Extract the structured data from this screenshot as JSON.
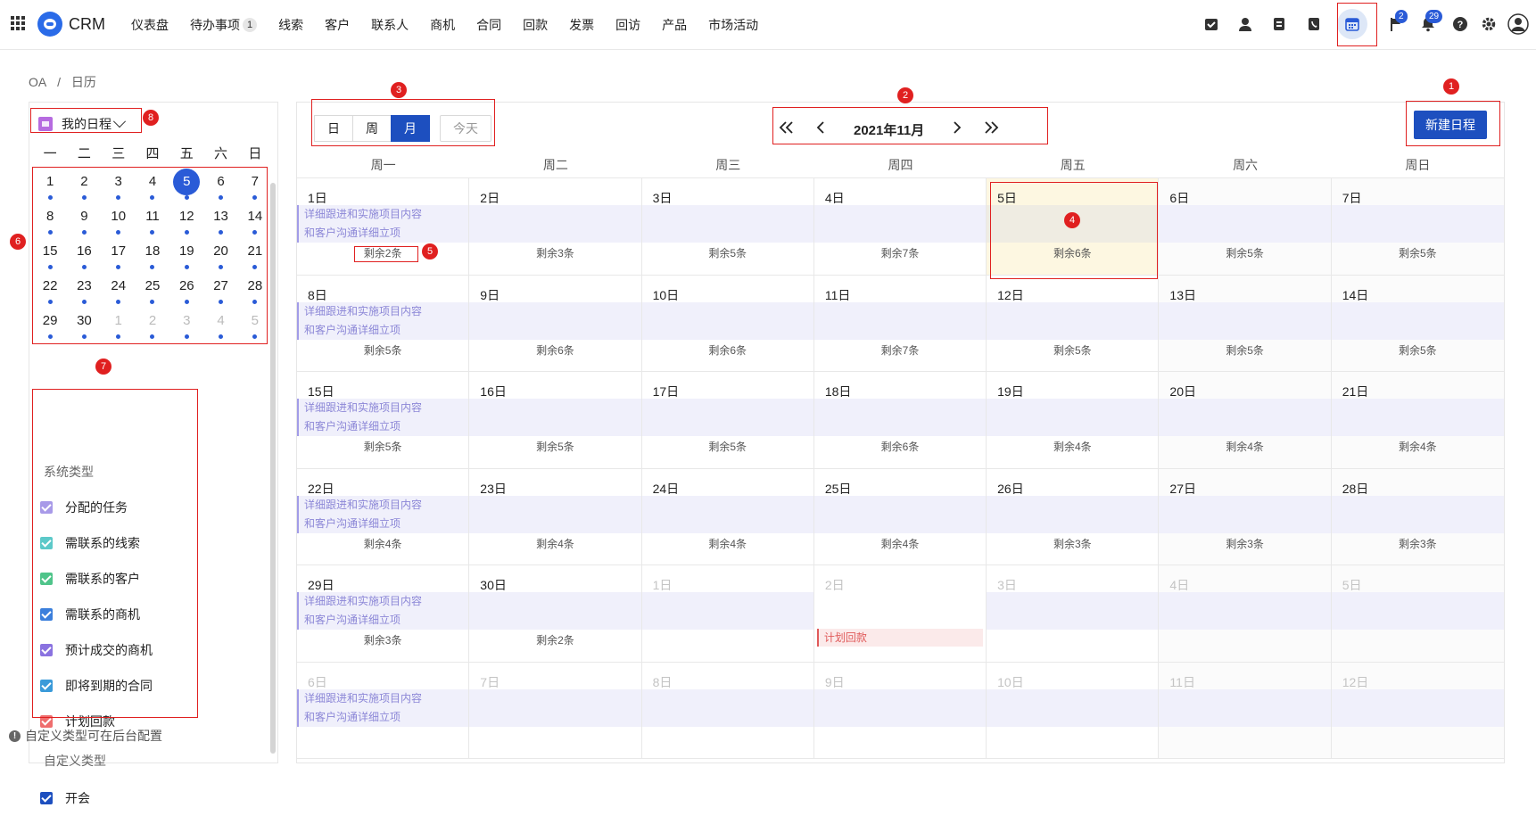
{
  "app": {
    "title": "CRM"
  },
  "nav": [
    {
      "label": "仪表盘"
    },
    {
      "label": "待办事项",
      "badge": "1"
    },
    {
      "label": "线索"
    },
    {
      "label": "客户"
    },
    {
      "label": "联系人"
    },
    {
      "label": "商机"
    },
    {
      "label": "合同"
    },
    {
      "label": "回款"
    },
    {
      "label": "发票"
    },
    {
      "label": "回访"
    },
    {
      "label": "产品"
    },
    {
      "label": "市场活动"
    }
  ],
  "top_icons": {
    "icons": [
      "task-check-icon",
      "user-icon",
      "document-icon",
      "contact-book-icon",
      "calendar-icon",
      "flag-icon",
      "bell-icon",
      "help-icon",
      "settings-icon",
      "avatar-icon"
    ],
    "flag_badge": "2",
    "bell_badge": "29"
  },
  "breadcrumb": [
    "OA",
    "/",
    "日历"
  ],
  "left_panel": {
    "my_calendar_label": "我的日程",
    "weekdays": [
      "一",
      "二",
      "三",
      "四",
      "五",
      "六",
      "日"
    ],
    "days": [
      {
        "d": "1",
        "dot": true
      },
      {
        "d": "2",
        "dot": true
      },
      {
        "d": "3",
        "dot": true
      },
      {
        "d": "4",
        "dot": true
      },
      {
        "d": "5",
        "dot": true,
        "selected": true
      },
      {
        "d": "6",
        "dot": true
      },
      {
        "d": "7",
        "dot": true
      },
      {
        "d": "8",
        "dot": true
      },
      {
        "d": "9",
        "dot": true
      },
      {
        "d": "10",
        "dot": true
      },
      {
        "d": "11",
        "dot": true
      },
      {
        "d": "12",
        "dot": true
      },
      {
        "d": "13",
        "dot": true
      },
      {
        "d": "14",
        "dot": true
      },
      {
        "d": "15",
        "dot": true
      },
      {
        "d": "16",
        "dot": true
      },
      {
        "d": "17",
        "dot": true
      },
      {
        "d": "18",
        "dot": true
      },
      {
        "d": "19",
        "dot": true
      },
      {
        "d": "20",
        "dot": true
      },
      {
        "d": "21",
        "dot": true
      },
      {
        "d": "22",
        "dot": true
      },
      {
        "d": "23",
        "dot": true
      },
      {
        "d": "24",
        "dot": true
      },
      {
        "d": "25",
        "dot": true
      },
      {
        "d": "26",
        "dot": true
      },
      {
        "d": "27",
        "dot": true
      },
      {
        "d": "28",
        "dot": true
      },
      {
        "d": "29",
        "dot": true
      },
      {
        "d": "30",
        "dot": true
      },
      {
        "d": "1",
        "dot": true,
        "muted": true
      },
      {
        "d": "2",
        "dot": true,
        "muted": true
      },
      {
        "d": "3",
        "dot": true,
        "muted": true
      },
      {
        "d": "4",
        "dot": true,
        "muted": true
      },
      {
        "d": "5",
        "dot": true,
        "muted": true
      }
    ],
    "system_types_label": "系统类型",
    "system_types": [
      {
        "label": "分配的任务",
        "color": "#a89ae8"
      },
      {
        "label": "需联系的线索",
        "color": "#5cc9c9"
      },
      {
        "label": "需联系的客户",
        "color": "#4fc48a"
      },
      {
        "label": "需联系的商机",
        "color": "#3b7fdc"
      },
      {
        "label": "预计成交的商机",
        "color": "#8a72e0"
      },
      {
        "label": "即将到期的合同",
        "color": "#3a9ad9"
      },
      {
        "label": "计划回款",
        "color": "#ef6e6e"
      }
    ],
    "custom_types_label": "自定义类型",
    "custom_types": [
      {
        "label": "开会",
        "color": "#1d4fbf"
      }
    ],
    "hint": "自定义类型可在后台配置"
  },
  "main": {
    "views": [
      "日",
      "周",
      "月"
    ],
    "active_view": "月",
    "today_label": "今天",
    "month_label": "2021年11月",
    "new_button": "新建日程",
    "weekdays": [
      "周一",
      "周二",
      "周三",
      "周四",
      "周五",
      "周六",
      "周日"
    ],
    "event_titles": [
      "详细跟进和实施项目内容",
      "和客户沟通详细立项"
    ],
    "cells": [
      {
        "date": "1日",
        "events": true,
        "more": "剩余2条"
      },
      {
        "date": "2日",
        "more": "剩余3条"
      },
      {
        "date": "3日",
        "more": "剩余5条"
      },
      {
        "date": "4日",
        "more": "剩余7条"
      },
      {
        "date": "5日",
        "more": "剩余6条",
        "highlight": true
      },
      {
        "date": "6日",
        "more": "剩余5条"
      },
      {
        "date": "7日",
        "more": "剩余5条"
      },
      {
        "date": "8日",
        "events": true,
        "more": "剩余5条"
      },
      {
        "date": "9日",
        "more": "剩余6条"
      },
      {
        "date": "10日",
        "more": "剩余6条"
      },
      {
        "date": "11日",
        "more": "剩余7条"
      },
      {
        "date": "12日",
        "more": "剩余5条"
      },
      {
        "date": "13日",
        "more": "剩余5条"
      },
      {
        "date": "14日",
        "more": "剩余5条"
      },
      {
        "date": "15日",
        "events": true,
        "more": "剩余5条"
      },
      {
        "date": "16日",
        "more": "剩余5条"
      },
      {
        "date": "17日",
        "more": "剩余5条"
      },
      {
        "date": "18日",
        "more": "剩余6条"
      },
      {
        "date": "19日",
        "more": "剩余4条"
      },
      {
        "date": "20日",
        "more": "剩余4条"
      },
      {
        "date": "21日",
        "more": "剩余4条"
      },
      {
        "date": "22日",
        "events": true,
        "more": "剩余4条"
      },
      {
        "date": "23日",
        "more": "剩余4条"
      },
      {
        "date": "24日",
        "more": "剩余4条"
      },
      {
        "date": "25日",
        "more": "剩余4条"
      },
      {
        "date": "26日",
        "more": "剩余3条"
      },
      {
        "date": "27日",
        "more": "剩余3条"
      },
      {
        "date": "28日",
        "more": "剩余3条"
      },
      {
        "date": "29日",
        "events": true,
        "more": "剩余3条"
      },
      {
        "date": "30日",
        "more": "剩余2条"
      },
      {
        "date": "1日",
        "other": true
      },
      {
        "date": "2日",
        "other": true,
        "payment": "计划回款"
      },
      {
        "date": "3日",
        "other": true
      },
      {
        "date": "4日",
        "other": true
      },
      {
        "date": "5日",
        "other": true
      },
      {
        "date": "6日",
        "other": true,
        "events": true
      },
      {
        "date": "7日",
        "other": true
      },
      {
        "date": "8日",
        "other": true
      },
      {
        "date": "9日",
        "other": true
      },
      {
        "date": "10日",
        "other": true
      },
      {
        "date": "11日",
        "other": true
      },
      {
        "date": "12日",
        "other": true
      }
    ]
  },
  "annotations": [
    "1",
    "2",
    "3",
    "4",
    "5",
    "6",
    "7",
    "8"
  ]
}
